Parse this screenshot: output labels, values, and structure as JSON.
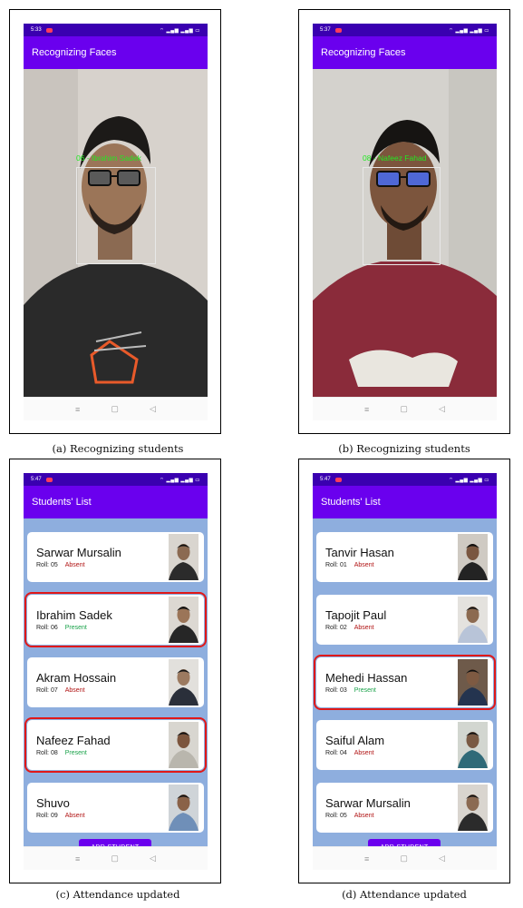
{
  "figure": {
    "panel_a": {
      "caption": "(a) Recognizing students",
      "status_time": "5:33",
      "app_title": "Recognizing Faces",
      "face_label": "06 - Ibrahim Sadek"
    },
    "panel_b": {
      "caption": "(b) Recognizing students",
      "status_time": "5:37",
      "app_title": "Recognizing Faces",
      "face_label": "08 - Nafeez Fahad"
    },
    "panel_c": {
      "caption": "(c) Attendance updated",
      "status_time": "5:47",
      "app_title": "Students' List",
      "add_button": "ADD STUDENT",
      "students": [
        {
          "name": "Sarwar Mursalin",
          "roll": "Roll: 05",
          "status": "Absent"
        },
        {
          "name": "Ibrahim Sadek",
          "roll": "Roll: 06",
          "status": "Present"
        },
        {
          "name": "Akram Hossain",
          "roll": "Roll: 07",
          "status": "Absent"
        },
        {
          "name": "Nafeez Fahad",
          "roll": "Roll: 08",
          "status": "Present"
        },
        {
          "name": "Shuvo",
          "roll": "Roll: 09",
          "status": "Absent"
        }
      ]
    },
    "panel_d": {
      "caption": "(d) Attendance updated",
      "status_time": "5:47",
      "app_title": "Students' List",
      "add_button": "ADD STUDENT",
      "students": [
        {
          "name": "Tanvir Hasan",
          "roll": "Roll: 01",
          "status": "Absent"
        },
        {
          "name": "Tapojit Paul",
          "roll": "Roll: 02",
          "status": "Absent"
        },
        {
          "name": "Mehedi Hassan",
          "roll": "Roll: 03",
          "status": "Present"
        },
        {
          "name": "Saiful Alam",
          "roll": "Roll: 04",
          "status": "Absent"
        },
        {
          "name": "Sarwar Mursalin",
          "roll": "Roll: 05",
          "status": "Absent"
        }
      ]
    }
  },
  "colors": {
    "statusbar": "#3a00b0",
    "appbar": "#6a00ee",
    "list_bg": "#8eaede",
    "present": "#1aa24a",
    "absent": "#b01212",
    "highlight": "#e01818",
    "face_label": "#22e822"
  },
  "icons": {
    "statusbar": [
      "recording-icon",
      "wifi-icon",
      "signal-icon",
      "battery-icon"
    ],
    "navbar": [
      "menu-icon",
      "home-icon",
      "back-icon"
    ]
  }
}
